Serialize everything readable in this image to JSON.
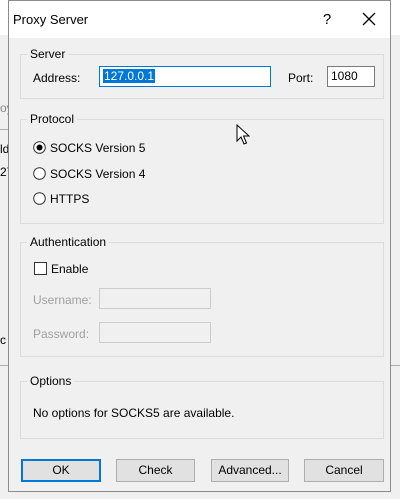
{
  "dialog": {
    "title": "Proxy Server",
    "help_label": "?",
    "server": {
      "legend": "Server",
      "address_label": "Address:",
      "address_value": "127.0.0.1",
      "port_label": "Port:",
      "port_value": "1080"
    },
    "protocol": {
      "legend": "Protocol",
      "options": [
        "SOCKS Version 5",
        "SOCKS Version 4",
        "HTTPS"
      ],
      "selected": "SOCKS Version 5"
    },
    "authentication": {
      "legend": "Authentication",
      "enable_label": "Enable",
      "enable_checked": false,
      "username_label": "Username:",
      "username_value": "",
      "password_label": "Password:",
      "password_value": ""
    },
    "options": {
      "legend": "Options",
      "message": "No options for SOCKS5 are available."
    },
    "buttons": {
      "ok": "OK",
      "check": "Check",
      "advanced": "Advanced...",
      "cancel": "Cancel"
    }
  },
  "background": {
    "fragments": [
      "oy",
      "ld",
      "27",
      "c"
    ]
  },
  "colors": {
    "accent": "#0078d7",
    "dialog_bg": "#f0f0f0",
    "group_border": "#dcdcdc",
    "disabled_text": "#a0a0a0"
  },
  "icons": {
    "close": "close-icon",
    "cursor": "mouse-pointer-icon"
  }
}
